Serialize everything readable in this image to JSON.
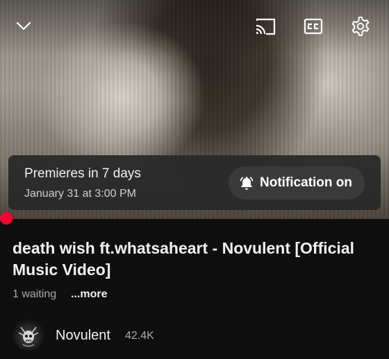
{
  "player": {
    "premiere_title": "Premieres in 7 days",
    "premiere_date": "January 31 at 3:00 PM",
    "notification_label": "Notification on",
    "icons": {
      "collapse": "chevron-down-icon",
      "cast": "cast-icon",
      "captions": "closed-captions-icon",
      "settings": "gear-icon",
      "bell": "bell-ringing-icon"
    },
    "progress_color": "#ff0033"
  },
  "video": {
    "title": "death wish ft.whatsaheart - Novulent [Official Music Video]",
    "waiting": "1 waiting",
    "more_label": "...more"
  },
  "channel": {
    "name": "Novulent",
    "subscribers": "42.4K"
  }
}
